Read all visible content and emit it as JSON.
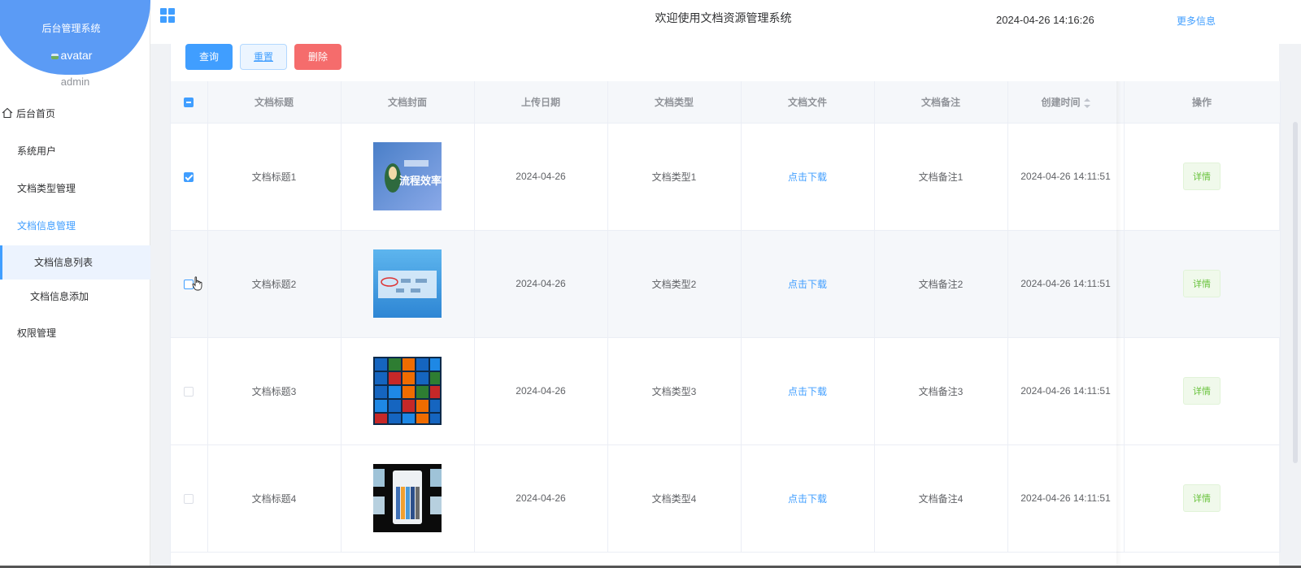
{
  "sidebar": {
    "brand_title": "后台管理系统",
    "avatar_alt": "avatar",
    "username": "admin",
    "items": [
      {
        "label": "后台首页"
      },
      {
        "label": "系统用户"
      },
      {
        "label": "文档类型管理"
      },
      {
        "label": "文档信息管理"
      },
      {
        "label": "文档信息列表"
      },
      {
        "label": "文档信息添加"
      },
      {
        "label": "权限管理"
      }
    ]
  },
  "header": {
    "title": "欢迎使用文档资源管理系统",
    "datetime": "2024-04-26 14:16:26",
    "more": "更多信息"
  },
  "toolbar": {
    "query": "查询",
    "reset": "重置",
    "delete": "删除"
  },
  "table": {
    "columns": [
      "文档标题",
      "文档封面",
      "上传日期",
      "文档类型",
      "文档文件",
      "文档备注",
      "创建时间",
      "操作"
    ],
    "rows": [
      {
        "title": "文档标题1",
        "date": "2024-04-26",
        "type": "文档类型1",
        "file": "点击下载",
        "note": "文档备注1",
        "created": "2024-04-26 14:11:51",
        "action": "详情",
        "checked": true
      },
      {
        "title": "文档标题2",
        "date": "2024-04-26",
        "type": "文档类型2",
        "file": "点击下载",
        "note": "文档备注2",
        "created": "2024-04-26 14:11:51",
        "action": "详情",
        "checked": false
      },
      {
        "title": "文档标题3",
        "date": "2024-04-26",
        "type": "文档类型3",
        "file": "点击下载",
        "note": "文档备注3",
        "created": "2024-04-26 14:11:51",
        "action": "详情",
        "checked": false
      },
      {
        "title": "文档标题4",
        "date": "2024-04-26",
        "type": "文档类型4",
        "file": "点击下载",
        "note": "文档备注4",
        "created": "2024-04-26 14:11:51",
        "action": "详情",
        "checked": false
      }
    ]
  },
  "thumb1_text": "流程效率",
  "colors": {
    "primary": "#409eff",
    "danger": "#f56c6c",
    "success": "#67c23a",
    "brand": "#5b9bf5"
  }
}
